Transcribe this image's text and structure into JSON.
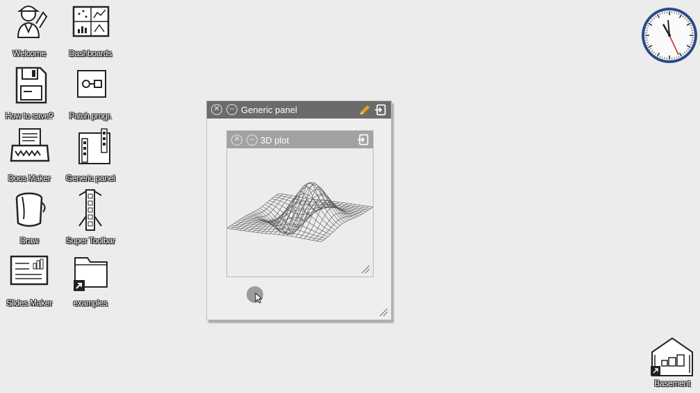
{
  "desktop": {
    "icons": [
      {
        "label": "Welcome"
      },
      {
        "label": "Dashboards"
      },
      {
        "label": "How to save?"
      },
      {
        "label": "Patch progr."
      },
      {
        "label": "Docs Maker"
      },
      {
        "label": "Generic panel"
      },
      {
        "label": "Draw"
      },
      {
        "label": "Super Toolbar"
      },
      {
        "label": "Slides Maker"
      },
      {
        "label": "examples"
      }
    ],
    "basement": {
      "label": "Basement"
    }
  },
  "panel": {
    "title": "Generic panel",
    "close_icon": "close-icon",
    "collapse_icon": "collapse-icon",
    "edit_icon": "pencil-icon",
    "edit_color": "#e0a92c",
    "embed_icon": "embed-icon"
  },
  "plot": {
    "title": "3D plot",
    "content": "3d-wireframe-surface"
  },
  "colors": {
    "background": "#ececec",
    "titlebar_dark": "#6b6b6b",
    "titlebar_light": "#a2a2a2",
    "clock_rim": "#2b4a8a",
    "clock_second_hand": "#d02020"
  }
}
